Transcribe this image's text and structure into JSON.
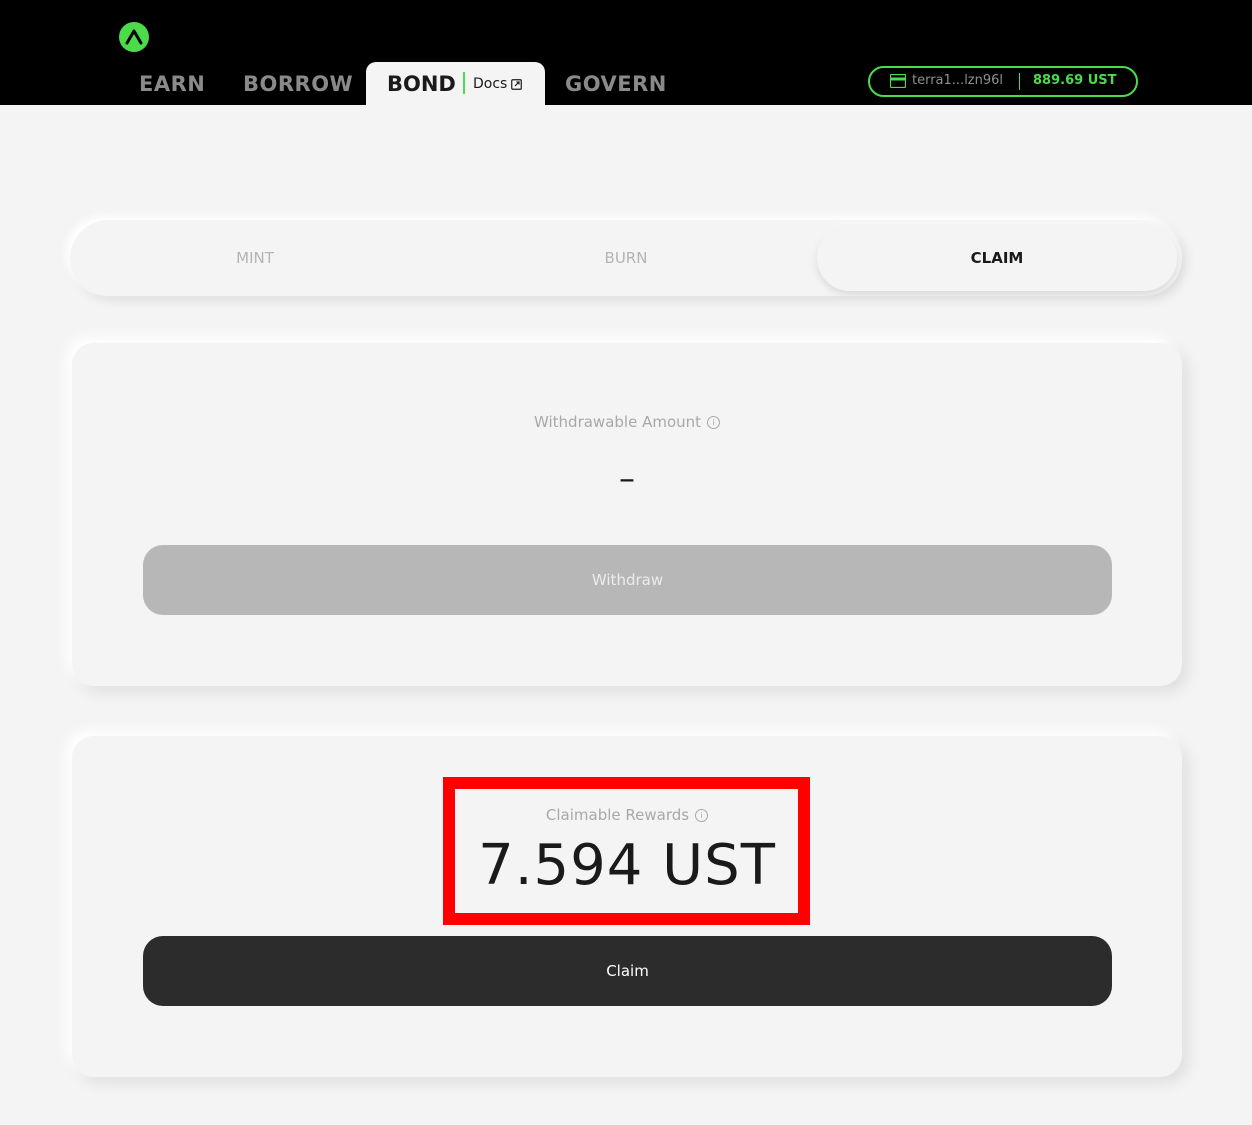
{
  "header": {
    "logo_icon": "anchor-logo-icon",
    "nav_tabs": [
      {
        "label": "EARN"
      },
      {
        "label": "BORROW"
      },
      {
        "label": "BOND"
      },
      {
        "label": "GOVERN"
      }
    ],
    "active_tab": "BOND",
    "docs_label": "Docs",
    "docs_icon": "external-link-icon",
    "wallet": {
      "icon": "wallet-icon",
      "address": "terra1...lzn96l",
      "balance": "889.69 UST",
      "accent_color": "#4bdb4b"
    }
  },
  "segmented_tabs": {
    "items": [
      {
        "label": "MINT"
      },
      {
        "label": "BURN"
      },
      {
        "label": "CLAIM"
      }
    ],
    "selected": "CLAIM"
  },
  "withdraw_card": {
    "label": "Withdrawable Amount",
    "value": "–",
    "button_label": "Withdraw",
    "button_enabled": false
  },
  "claim_card": {
    "label": "Claimable Rewards",
    "value": "7.594 UST",
    "button_label": "Claim",
    "button_enabled": true
  },
  "colors": {
    "accent": "#4bdb4b",
    "background": "#f4f4f4",
    "header_bg": "#000000",
    "highlight": "#ff0000"
  }
}
